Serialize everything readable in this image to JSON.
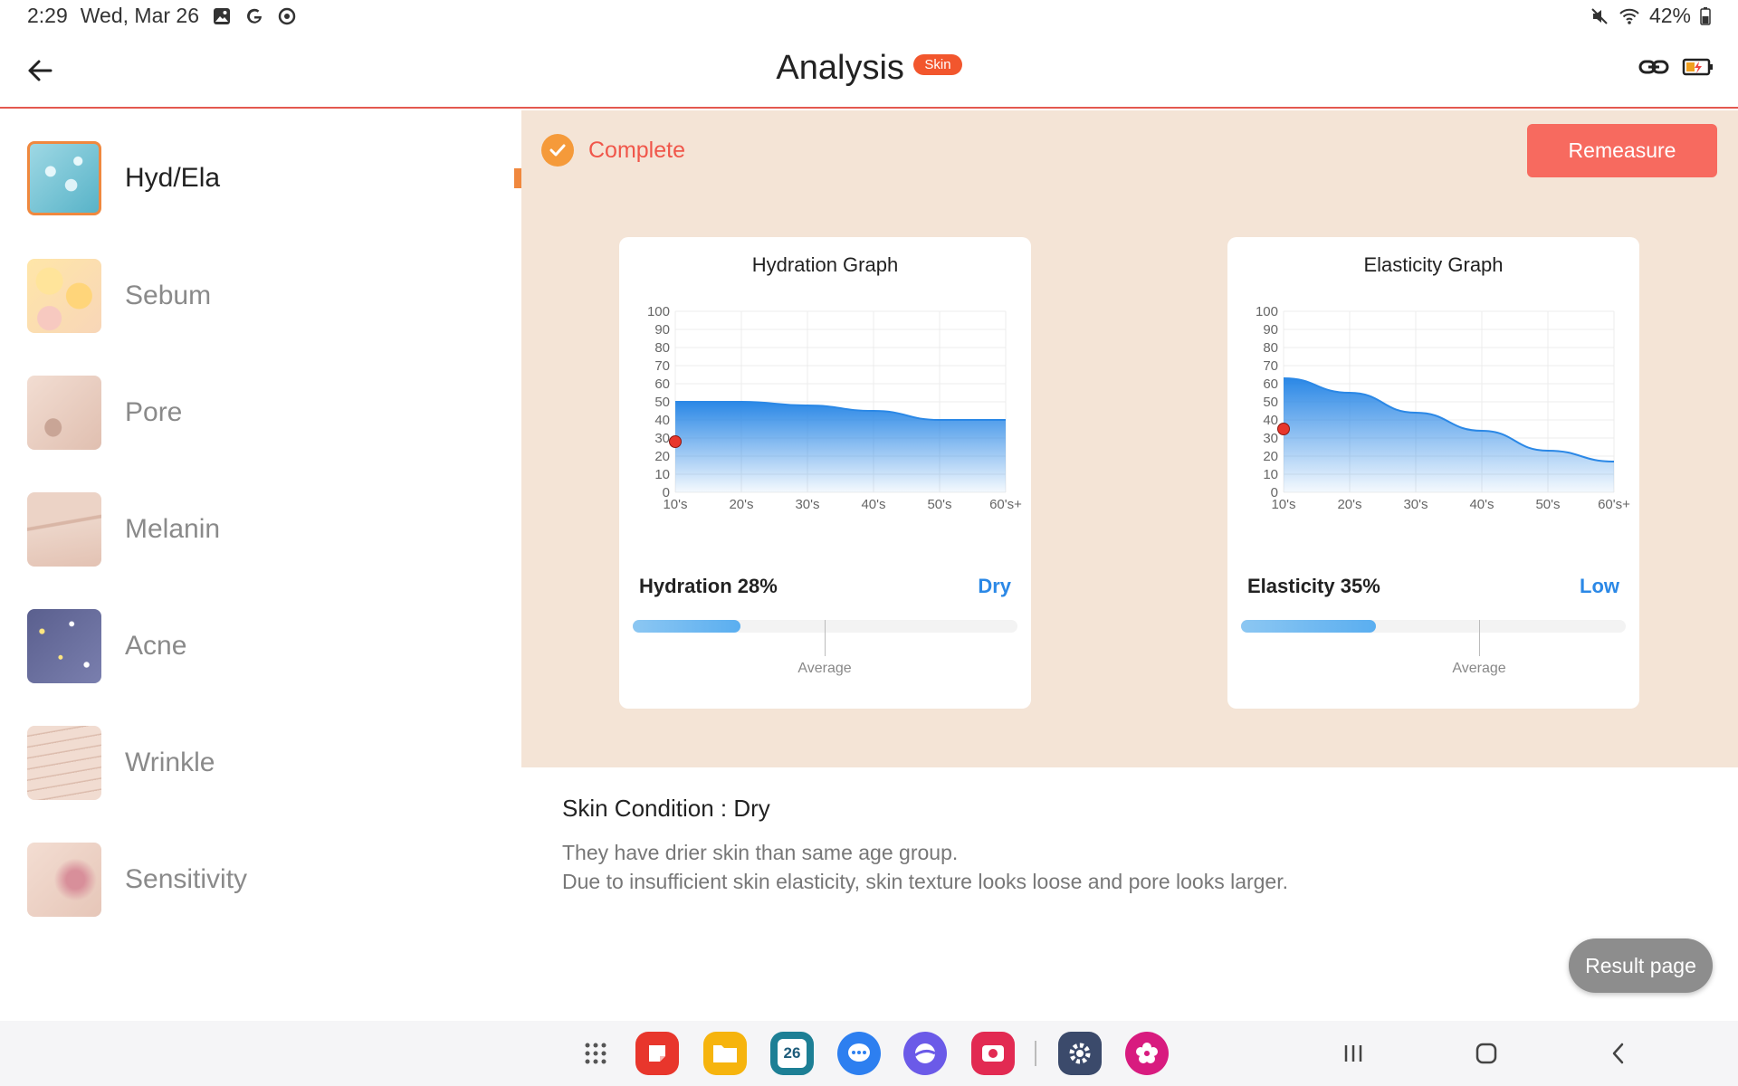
{
  "status_bar": {
    "time": "2:29",
    "date": "Wed, Mar 26",
    "battery": "42%",
    "left_icons": [
      "gallery-icon",
      "google-icon",
      "assistant-icon"
    ],
    "right_icons": [
      "mute-icon",
      "wifi-icon",
      "battery-icon"
    ]
  },
  "header": {
    "title": "Analysis",
    "badge": "Skin"
  },
  "sidebar": {
    "items": [
      {
        "label": "Hyd/Ela",
        "active": true
      },
      {
        "label": "Sebum"
      },
      {
        "label": "Pore"
      },
      {
        "label": "Melanin"
      },
      {
        "label": "Acne"
      },
      {
        "label": "Wrinkle"
      },
      {
        "label": "Sensitivity"
      }
    ]
  },
  "panel": {
    "status": "Complete",
    "remeasure_label": "Remeasure",
    "hydration": {
      "title": "Hydration Graph",
      "metric": "Hydration 28%",
      "status": "Dry",
      "average_label": "Average",
      "value_percent": 28
    },
    "elasticity": {
      "title": "Elasticity Graph",
      "metric": "Elasticity 35%",
      "status": "Low",
      "average_label": "Average",
      "value_percent": 35
    }
  },
  "chart_data": [
    {
      "type": "area",
      "title": "Hydration Graph",
      "categories": [
        "10's",
        "20's",
        "30's",
        "40's",
        "50's",
        "60's+"
      ],
      "series": [
        {
          "values": [
            50,
            50,
            48,
            45,
            40,
            40
          ]
        }
      ],
      "marker": {
        "x": "10's",
        "y": 28
      },
      "ylim": [
        0,
        100
      ],
      "yticks": [
        0,
        10,
        20,
        30,
        40,
        50,
        60,
        70,
        80,
        90,
        100
      ],
      "grid": true
    },
    {
      "type": "area",
      "title": "Elasticity Graph",
      "categories": [
        "10's",
        "20's",
        "30's",
        "40's",
        "50's",
        "60's+"
      ],
      "series": [
        {
          "values": [
            63,
            55,
            44,
            34,
            23,
            17
          ]
        }
      ],
      "marker": {
        "x": "10's",
        "y": 35
      },
      "ylim": [
        0,
        100
      ],
      "yticks": [
        0,
        10,
        20,
        30,
        40,
        50,
        60,
        70,
        80,
        90,
        100
      ],
      "grid": true
    }
  ],
  "description": {
    "condition": "Skin Condition : Dry",
    "lines": [
      "They have drier skin than same age group.",
      "Due to insufficient skin elasticity, skin texture looks loose and pore looks larger."
    ]
  },
  "result_button": "Result page",
  "dock": {
    "apps": [
      "app-drawer-icon",
      "notes-app-icon",
      "files-app-icon",
      "calendar-app-icon",
      "messages-app-icon",
      "internet-app-icon",
      "screen-recorder-icon",
      "settings-app-icon",
      "blossom-app-icon"
    ],
    "calendar_day": "26"
  },
  "colors": {
    "accent": "#f76a5f",
    "panel_bg": "#f4e4d6",
    "chart_blue": "#2b88e6",
    "check": "#f59a3a"
  }
}
